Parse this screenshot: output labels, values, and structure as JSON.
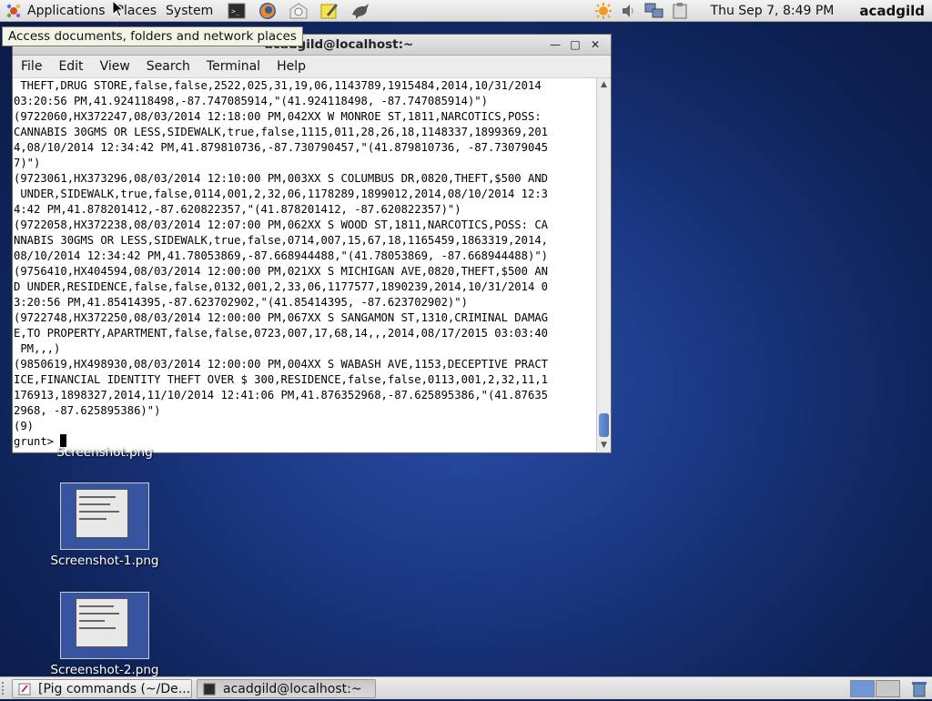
{
  "top_panel": {
    "menus": [
      "Applications",
      "Places",
      "System"
    ],
    "clock": "Thu Sep  7,  8:49 PM",
    "user": "acadgild"
  },
  "tooltip": "Access documents, folders and network places",
  "terminal": {
    "title": "acadgild@localhost:~",
    "menu": [
      "File",
      "Edit",
      "View",
      "Search",
      "Terminal",
      "Help"
    ],
    "lines": [
      " THEFT,DRUG STORE,false,false,2522,025,31,19,06,1143789,1915484,2014,10/31/2014",
      "03:20:56 PM,41.924118498,-87.747085914,\"(41.924118498, -87.747085914)\")",
      "(9722060,HX372247,08/03/2014 12:18:00 PM,042XX W MONROE ST,1811,NARCOTICS,POSS:",
      "CANNABIS 30GMS OR LESS,SIDEWALK,true,false,1115,011,28,26,18,1148337,1899369,201",
      "4,08/10/2014 12:34:42 PM,41.879810736,-87.730790457,\"(41.879810736, -87.73079045",
      "7)\")",
      "(9723061,HX373296,08/03/2014 12:10:00 PM,003XX S COLUMBUS DR,0820,THEFT,$500 AND",
      " UNDER,SIDEWALK,true,false,0114,001,2,32,06,1178289,1899012,2014,08/10/2014 12:3",
      "4:42 PM,41.878201412,-87.620822357,\"(41.878201412, -87.620822357)\")",
      "(9722058,HX372238,08/03/2014 12:07:00 PM,062XX S WOOD ST,1811,NARCOTICS,POSS: CA",
      "NNABIS 30GMS OR LESS,SIDEWALK,true,false,0714,007,15,67,18,1165459,1863319,2014,",
      "08/10/2014 12:34:42 PM,41.78053869,-87.668944488,\"(41.78053869, -87.668944488)\")",
      "(9756410,HX404594,08/03/2014 12:00:00 PM,021XX S MICHIGAN AVE,0820,THEFT,$500 AN",
      "D UNDER,RESIDENCE,false,false,0132,001,2,33,06,1177577,1890239,2014,10/31/2014 0",
      "3:20:56 PM,41.85414395,-87.623702902,\"(41.85414395, -87.623702902)\")",
      "(9722748,HX372250,08/03/2014 12:00:00 PM,067XX S SANGAMON ST,1310,CRIMINAL DAMAG",
      "E,TO PROPERTY,APARTMENT,false,false,0723,007,17,68,14,,,2014,08/17/2015 03:03:40",
      " PM,,,)",
      "(9850619,HX498930,08/03/2014 12:00:00 PM,004XX S WABASH AVE,1153,DECEPTIVE PRACT",
      "ICE,FINANCIAL IDENTITY THEFT OVER $ 300,RESIDENCE,false,false,0113,001,2,32,11,1",
      "176913,1898327,2014,11/10/2014 12:41:06 PM,41.876352968,-87.625895386,\"(41.87635",
      "2968, -87.625895386)\")",
      "(9)"
    ],
    "prompt": "grunt> "
  },
  "desktop": {
    "partial_label": "Screenshot.png",
    "icons": [
      "Screenshot-1.png",
      "Screenshot-2.png"
    ]
  },
  "taskbar": {
    "tasks": [
      "[Pig commands (~/De...",
      "acadgild@localhost:~"
    ]
  }
}
